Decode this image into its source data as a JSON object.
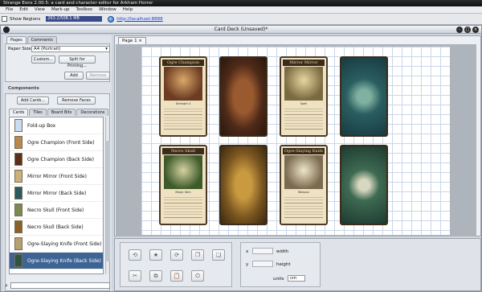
{
  "app": {
    "title": "Strange Eons 2.00.5: a card and character editor for Arkham Horror"
  },
  "menu": [
    "File",
    "Edit",
    "View",
    "Mark-up",
    "Toolbox",
    "Window",
    "Help"
  ],
  "toolbar": {
    "show_regions": "Show Regions",
    "memory": "263.2/508.1 MB",
    "url": "http://localhost:8888"
  },
  "window": {
    "title": "Card Deck (Unsaved)*"
  },
  "left": {
    "tabs": [
      "Pages",
      "Comments"
    ],
    "paper_size_label": "Paper Size",
    "paper_size_value": "A4 (Portrait)",
    "custom_btn": "Custom...",
    "split_btn": "Split for Printing...",
    "add_btn": "Add",
    "remove_btn": "Remove",
    "components_label": "Components",
    "add_cards_btn": "Add Cards...",
    "remove_faces_btn": "Remove Faces",
    "comp_tabs": [
      "Cards",
      "Tiles",
      "Board Bits",
      "Decorations"
    ],
    "items": [
      {
        "label": "Fold-up Box",
        "color": "#c9dcf2"
      },
      {
        "label": "Ogre Champion (Front Side)",
        "color": "#b8894e"
      },
      {
        "label": "Ogre Champion (Back Side)",
        "color": "#5a2f1c"
      },
      {
        "label": "Mirror Mirror (Front Side)",
        "color": "#cbb07a"
      },
      {
        "label": "Mirror Mirror (Back Side)",
        "color": "#2c5a5e"
      },
      {
        "label": "Necro Skull (Front Side)",
        "color": "#7b8a52"
      },
      {
        "label": "Necro Skull (Back Side)",
        "color": "#8a6228"
      },
      {
        "label": "Ogre-Slaying Knife (Front Side)",
        "color": "#b7a070"
      },
      {
        "label": "Ogre-Slaying Knife (Back Side)",
        "color": "#2f5540"
      }
    ]
  },
  "canvas": {
    "page_tab": "Page 1",
    "cards": [
      {
        "title": "Ogre Champion",
        "sub": "Strength 4"
      },
      {
        "title": "Mirror Mirror",
        "sub": "Spell"
      },
      {
        "title": "Necro Skull",
        "sub": "Magic Item"
      },
      {
        "title": "Ogre-Slaying Knife",
        "sub": "Weapon"
      }
    ]
  },
  "geometry": {
    "x_label": "x",
    "y_label": "y",
    "width_label": "width",
    "height_label": "height",
    "units_label": "units",
    "units_value": "cm"
  }
}
